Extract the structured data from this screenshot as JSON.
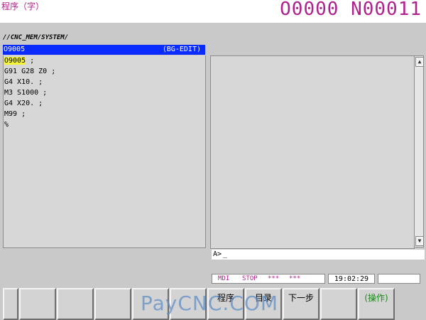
{
  "header": {
    "screen_title": "程序（字）",
    "program_numbers": "O0000 N00011"
  },
  "path": "//CNC_MEM/SYSTEM/",
  "program_bar": {
    "name": "O9005",
    "mode": "(BG-EDIT)"
  },
  "code_lines": [
    {
      "highlight": "O9005",
      "rest": " ;"
    },
    {
      "highlight": "",
      "rest": "G91 G28 Z0 ;"
    },
    {
      "highlight": "",
      "rest": "G4 X10. ;"
    },
    {
      "highlight": "",
      "rest": "M3 S1000 ;"
    },
    {
      "highlight": "",
      "rest": "G4 X20. ;"
    },
    {
      "highlight": "",
      "rest": "M99 ;"
    },
    {
      "highlight": "",
      "rest": "%"
    }
  ],
  "input": {
    "prompt": "A>",
    "cursor": "_"
  },
  "status": {
    "mode": "MDI",
    "state": "STOP",
    "alarm1": "***",
    "alarm2": "***",
    "time": "19:02:29"
  },
  "softkeys": [
    "",
    "",
    "",
    "",
    "",
    "",
    "程序",
    "目录",
    "下一步",
    "",
    "(操作)"
  ],
  "watermark": {
    "brand": "PayCNC.COM"
  },
  "colors": {
    "title": "#b0208e",
    "program_bar": "#0a2bff",
    "highlight": "#f3f33a"
  }
}
